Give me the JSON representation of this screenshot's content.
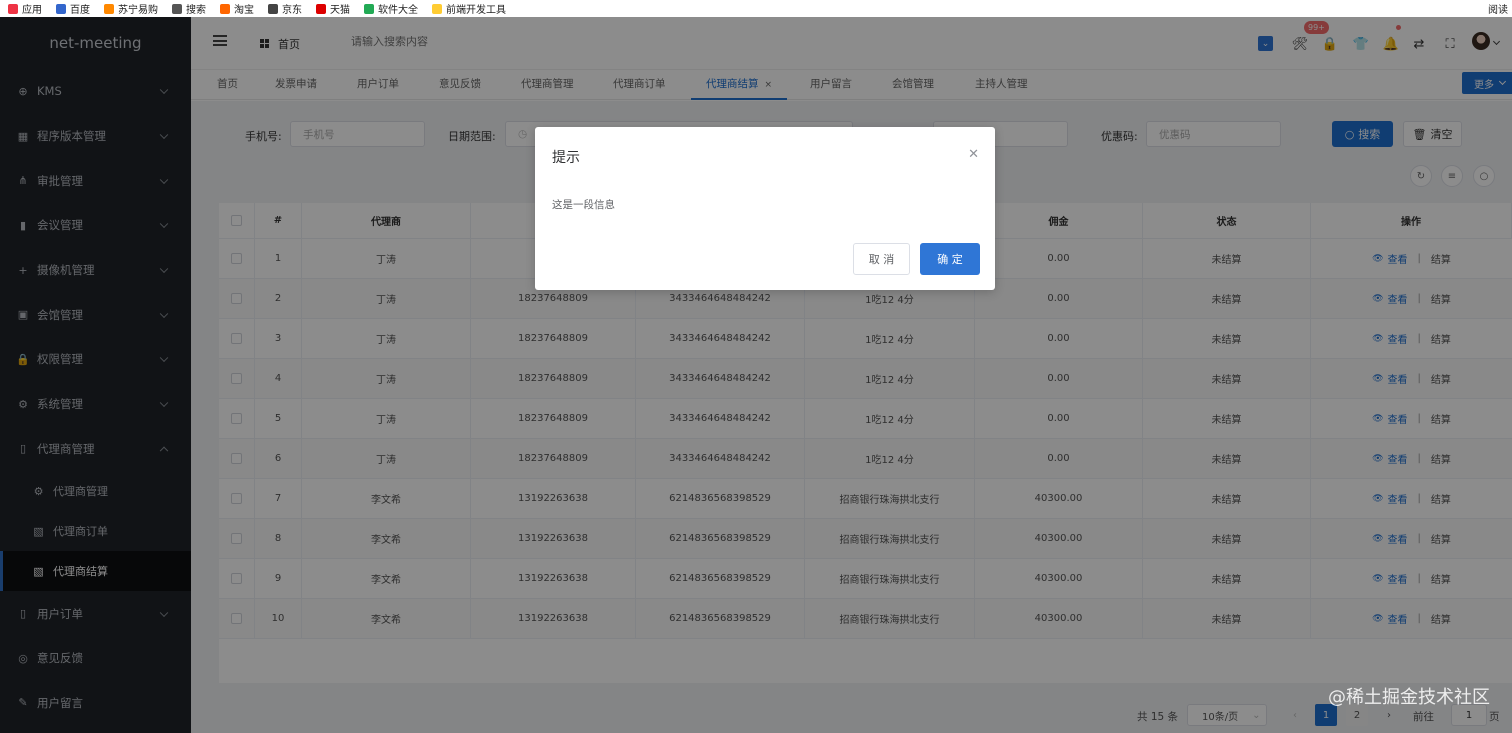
{
  "bookmarks": [
    "应用",
    "百度",
    "苏宁易购",
    "搜索",
    "淘宝",
    "京东",
    "天猫",
    "软件大全",
    "前端开发工具"
  ],
  "bookmarks_right": "阅读",
  "sidebar": {
    "logo": "net-meeting",
    "items": [
      {
        "label": "KMS",
        "icon": "plus-circle-icon",
        "arrow": "down"
      },
      {
        "label": "程序版本管理",
        "icon": "grid-icon",
        "arrow": "down"
      },
      {
        "label": "审批管理",
        "icon": "org-chart-icon",
        "arrow": "down"
      },
      {
        "label": "会议管理",
        "icon": "bar-chart-icon",
        "arrow": "down"
      },
      {
        "label": "摄像机管理",
        "icon": "plus-icon",
        "arrow": "down"
      },
      {
        "label": "会馆管理",
        "icon": "wallet-icon",
        "arrow": "down"
      },
      {
        "label": "权限管理",
        "icon": "lock-icon",
        "arrow": "down"
      },
      {
        "label": "系统管理",
        "icon": "gear-icon",
        "arrow": "down"
      },
      {
        "label": "代理商管理",
        "icon": "book-icon",
        "arrow": "up"
      }
    ],
    "sub_items": [
      {
        "label": "代理商管理",
        "icon": "gear-icon"
      },
      {
        "label": "代理商订单",
        "icon": "receipt-icon"
      },
      {
        "label": "代理商结算",
        "icon": "receipt-icon",
        "active": true
      }
    ],
    "bottom_items": [
      {
        "label": "用户订单",
        "icon": "phone-icon",
        "arrow": "down"
      },
      {
        "label": "意见反馈",
        "icon": "location-icon"
      },
      {
        "label": "用户留言",
        "icon": "edit-icon"
      }
    ]
  },
  "header": {
    "breadcrumb": "首页",
    "search_placeholder": "请输入搜索内容",
    "badge": "99+"
  },
  "tabs": [
    "首页",
    "发票申请",
    "用户订单",
    "意见反馈",
    "代理商管理",
    "代理商订单",
    "代理商结算",
    "用户留言",
    "会馆管理",
    "主持人管理"
  ],
  "active_tab": "代理商结算",
  "more_label": "更多",
  "filter": {
    "phone_label": "手机号:",
    "phone_placeholder": "手机号",
    "date_label": "日期范围:",
    "coupon_label": "优惠码:",
    "coupon_placeholder": "优惠码",
    "search_btn": "搜索",
    "clear_btn": "清空"
  },
  "table": {
    "headers": [
      "#",
      "代理商",
      "",
      "",
      "",
      "佣金",
      "状态",
      "操作"
    ],
    "rows": [
      {
        "no": "1",
        "agent": "丁涛",
        "phone": "18",
        "card": "",
        "bank": "",
        "commission": "0.00",
        "status": "未结算"
      },
      {
        "no": "2",
        "agent": "丁涛",
        "phone": "18237648809",
        "card": "3433464648484242",
        "bank": "1吃12 4分",
        "commission": "0.00",
        "status": "未结算"
      },
      {
        "no": "3",
        "agent": "丁涛",
        "phone": "18237648809",
        "card": "3433464648484242",
        "bank": "1吃12 4分",
        "commission": "0.00",
        "status": "未结算"
      },
      {
        "no": "4",
        "agent": "丁涛",
        "phone": "18237648809",
        "card": "3433464648484242",
        "bank": "1吃12 4分",
        "commission": "0.00",
        "status": "未结算"
      },
      {
        "no": "5",
        "agent": "丁涛",
        "phone": "18237648809",
        "card": "3433464648484242",
        "bank": "1吃12 4分",
        "commission": "0.00",
        "status": "未结算"
      },
      {
        "no": "6",
        "agent": "丁涛",
        "phone": "18237648809",
        "card": "3433464648484242",
        "bank": "1吃12 4分",
        "commission": "0.00",
        "status": "未结算"
      },
      {
        "no": "7",
        "agent": "李文希",
        "phone": "13192263638",
        "card": "6214836568398529",
        "bank": "招商银行珠海拱北支行",
        "commission": "40300.00",
        "status": "未结算"
      },
      {
        "no": "8",
        "agent": "李文希",
        "phone": "13192263638",
        "card": "6214836568398529",
        "bank": "招商银行珠海拱北支行",
        "commission": "40300.00",
        "status": "未结算"
      },
      {
        "no": "9",
        "agent": "李文希",
        "phone": "13192263638",
        "card": "6214836568398529",
        "bank": "招商银行珠海拱北支行",
        "commission": "40300.00",
        "status": "未结算"
      },
      {
        "no": "10",
        "agent": "李文希",
        "phone": "13192263638",
        "card": "6214836568398529",
        "bank": "招商银行珠海拱北支行",
        "commission": "40300.00",
        "status": "未结算"
      }
    ],
    "view_label": "查看",
    "settle_label": "结算"
  },
  "pagination": {
    "total": "共 15 条",
    "page_size": "10条/页",
    "pages": [
      "1",
      "2"
    ],
    "current": "1",
    "goto_label": "前往",
    "goto_value": "1",
    "page_unit": "页"
  },
  "dialog": {
    "title": "提示",
    "message": "这是一段信息",
    "cancel": "取 消",
    "confirm": "确 定"
  },
  "watermark": "@稀土掘金技术社区"
}
